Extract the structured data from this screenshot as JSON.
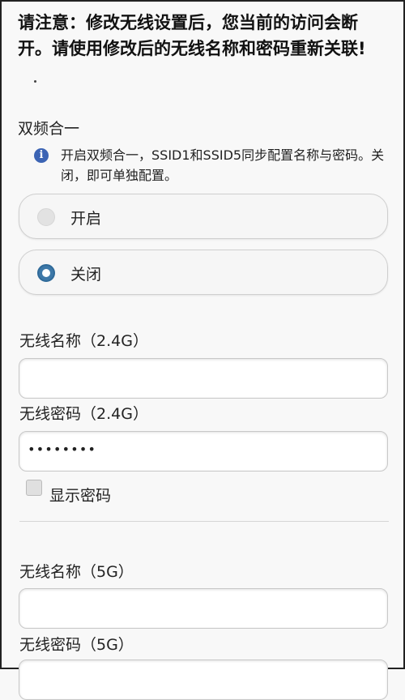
{
  "warning": "请注意：修改无线设置后，您当前的访问会断开。请使用修改后的无线名称和密码重新关联!",
  "dual_band": {
    "title": "双频合一",
    "info_icon": "info-icon",
    "info_text": "开启双频合一，SSID1和SSID5同步配置名称与密码。关闭，即可单独配置。",
    "options": [
      {
        "label": "开启",
        "selected": false
      },
      {
        "label": "关闭",
        "selected": true
      }
    ]
  },
  "band_24": {
    "ssid_label": "无线名称（2.4G）",
    "ssid_value": "",
    "password_label": "无线密码（2.4G）",
    "password_value": "••••••••"
  },
  "show_password": {
    "label": "显示密码",
    "checked": false
  },
  "band_5": {
    "ssid_label": "无线名称（5G）",
    "ssid_value": "",
    "password_label": "无线密码（5G）"
  }
}
